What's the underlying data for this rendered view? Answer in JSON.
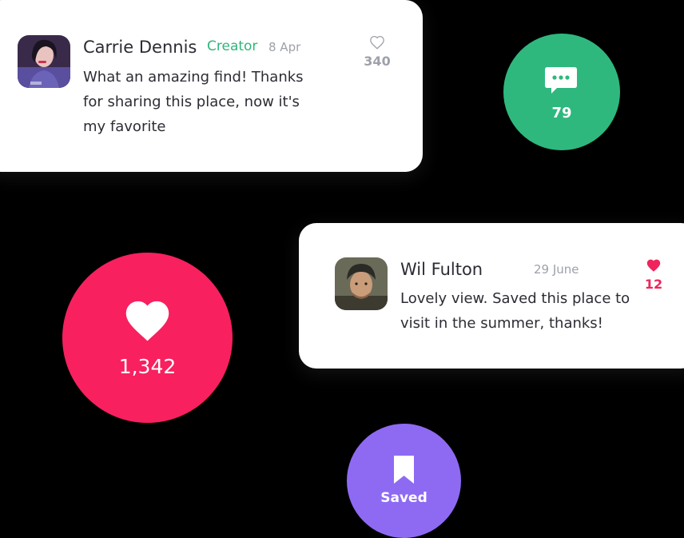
{
  "colors": {
    "background": "#000000",
    "card": "#ffffff",
    "creator": "#30b57a",
    "likes_bubble": "#f8205f",
    "comments_bubble": "#2fb87e",
    "saved_bubble": "#8e6af3",
    "liked_heart": "#f0245c"
  },
  "comments": [
    {
      "author": "Carrie Dennis",
      "role": "Creator",
      "date": "8 Apr",
      "text": "What an amazing find! Thanks for sharing this place, now it's my favorite",
      "likes": "340",
      "liked": false,
      "like_icon": "heart-outline-icon"
    },
    {
      "author": "Wil Fulton",
      "date": "29 June",
      "text": "Lovely view. Saved this place to visit in the summer, thanks!",
      "likes": "12",
      "liked": true,
      "like_icon": "heart-filled-icon"
    }
  ],
  "stats": {
    "comments": {
      "icon": "chat-bubble-icon",
      "count": "79"
    },
    "likes": {
      "icon": "heart-icon",
      "count": "1,342"
    },
    "saved": {
      "icon": "bookmark-icon",
      "label": "Saved"
    }
  }
}
